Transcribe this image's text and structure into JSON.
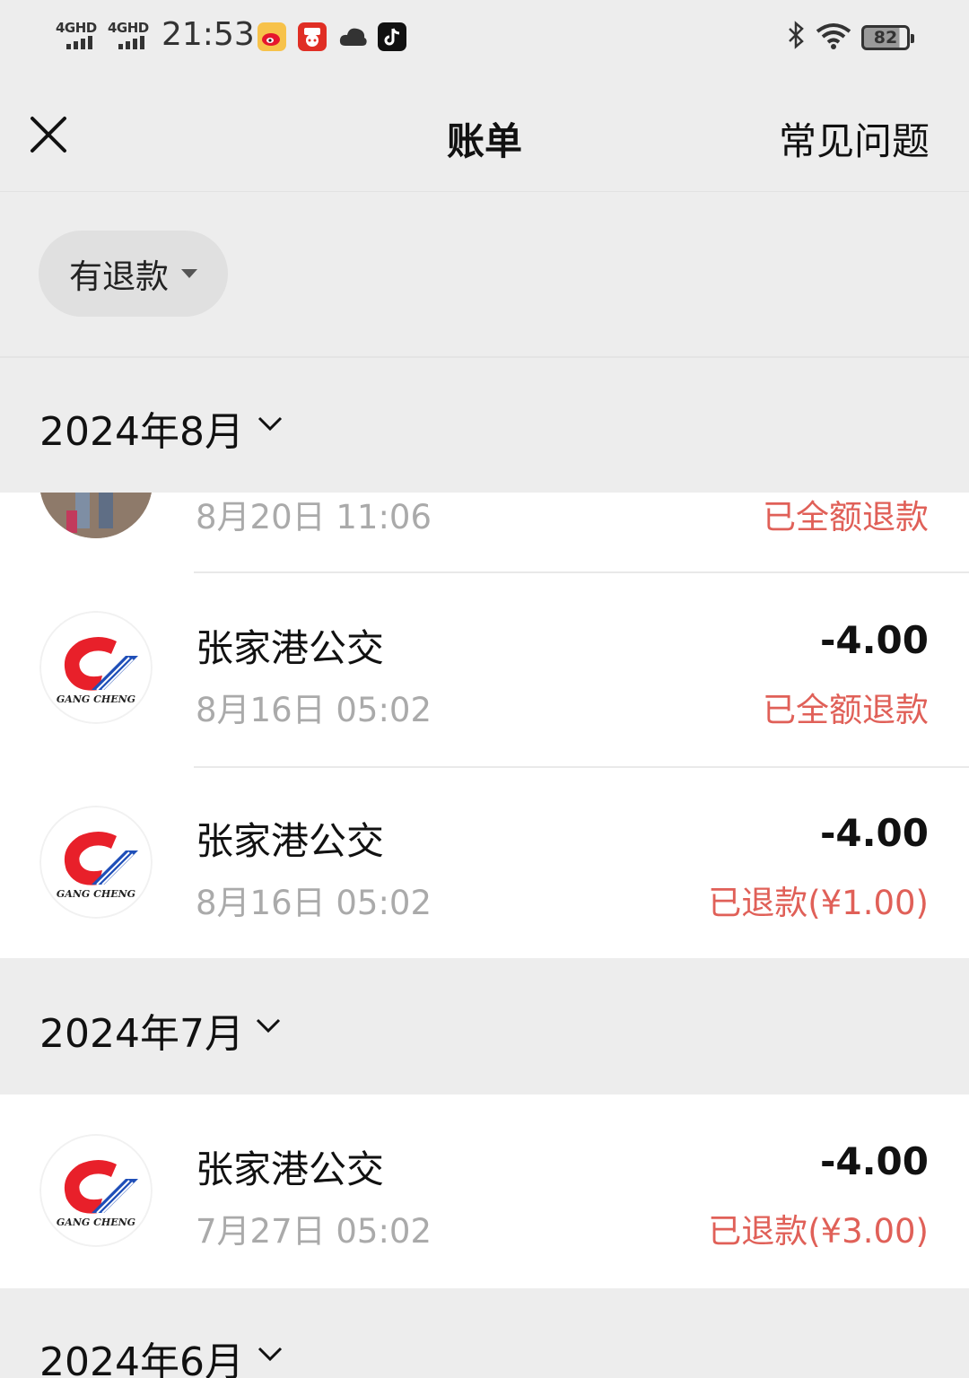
{
  "status_bar": {
    "signal1": "4GHD",
    "signal2": "4GHD",
    "time": "21:53",
    "battery": "82",
    "app_icons": [
      "weibo-icon",
      "pinduoduo-icon",
      "cloud-icon",
      "tiktok-icon"
    ]
  },
  "header": {
    "close_icon": "close-icon",
    "title": "账单",
    "faq_label": "常见问题"
  },
  "filter": {
    "label": "有退款",
    "icon": "caret-down-icon"
  },
  "months": [
    {
      "label": "2024年8月"
    },
    {
      "label": "2024年7月"
    },
    {
      "label": "2024年6月"
    }
  ],
  "aug_rows": [
    {
      "merchant": "",
      "time": "8月20日 11:06",
      "amount": "",
      "status": "已全额退款",
      "avatar": "photo-avatar"
    },
    {
      "merchant": "张家港公交",
      "time": "8月16日 05:02",
      "amount": "-4.00",
      "status": "已全额退款",
      "avatar": "gangcheng-logo"
    },
    {
      "merchant": "张家港公交",
      "time": "8月16日 05:02",
      "amount": "-4.00",
      "status": "已退款(¥1.00)",
      "avatar": "gangcheng-logo"
    }
  ],
  "jul_rows": [
    {
      "merchant": "张家港公交",
      "time": "7月27日 05:02",
      "amount": "-4.00",
      "status": "已退款(¥3.00)",
      "avatar": "gangcheng-logo"
    }
  ],
  "logo_text": "GANG CHENG",
  "colors": {
    "background": "#ededed",
    "refund_red": "#e06058",
    "secondary_text": "#aaaaaa",
    "logo_red": "#e8202a",
    "logo_blue": "#1f4fb8"
  }
}
